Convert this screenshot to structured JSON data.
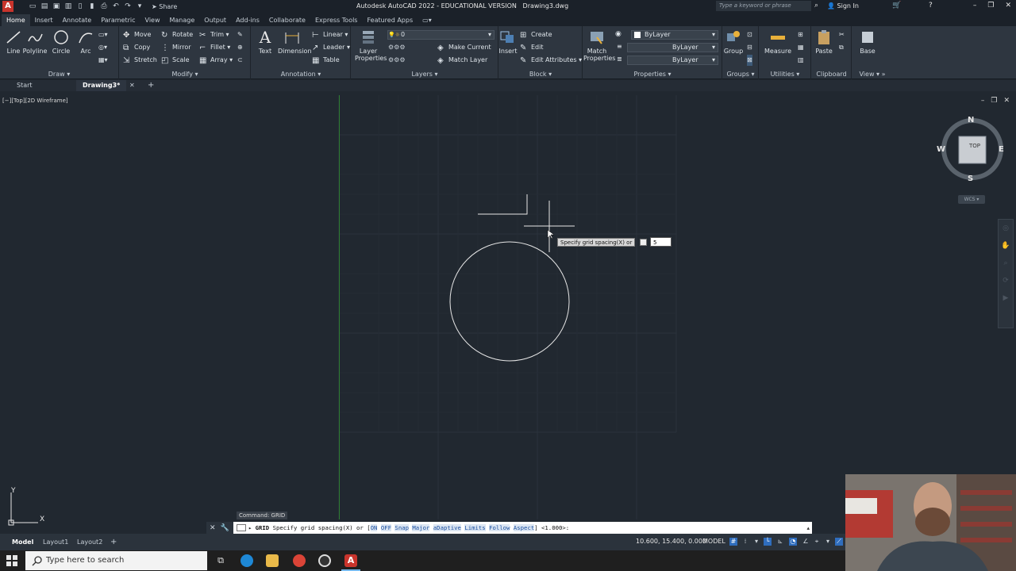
{
  "titlebar": {
    "app_title": "Autodesk AutoCAD 2022 - EDUCATIONAL VERSION",
    "file_name": "Drawing3.dwg",
    "share_label": "Share",
    "search_placeholder": "Type a keyword or phrase",
    "sign_in": "Sign In"
  },
  "ribbon_tabs": [
    "Home",
    "Insert",
    "Annotate",
    "Parametric",
    "View",
    "Manage",
    "Output",
    "Add-ins",
    "Collaborate",
    "Express Tools",
    "Featured Apps"
  ],
  "ribbon": {
    "draw": {
      "title": "Draw",
      "line": "Line",
      "polyline": "Polyline",
      "circle": "Circle",
      "arc": "Arc"
    },
    "modify": {
      "title": "Modify",
      "move": "Move",
      "rotate": "Rotate",
      "trim": "Trim",
      "copy": "Copy",
      "mirror": "Mirror",
      "fillet": "Fillet",
      "stretch": "Stretch",
      "scale": "Scale",
      "array": "Array"
    },
    "annotation": {
      "title": "Annotation",
      "text": "Text",
      "dimension": "Dimension",
      "linear": "Linear",
      "leader": "Leader",
      "table": "Table"
    },
    "layers": {
      "title": "Layers",
      "layer_properties_1": "Layer",
      "layer_properties_2": "Properties",
      "current_layer": "0",
      "make_current": "Make Current",
      "match_layer": "Match Layer"
    },
    "block": {
      "title": "Block",
      "insert": "Insert",
      "create": "Create",
      "edit": "Edit",
      "edit_attributes": "Edit Attributes"
    },
    "properties": {
      "title": "Properties",
      "match_1": "Match",
      "match_2": "Properties",
      "color": "ByLayer",
      "linetype": "ByLayer",
      "lineweight": "ByLayer"
    },
    "groups": {
      "title": "Groups",
      "group": "Group"
    },
    "utilities": {
      "title": "Utilities",
      "measure": "Measure"
    },
    "clipboard": {
      "title": "Clipboard",
      "paste": "Paste"
    },
    "view": {
      "title": "View",
      "base": "Base"
    }
  },
  "file_tabs": {
    "start": "Start",
    "drawing": "Drawing3*"
  },
  "viewport": {
    "label": "[−][Top][2D Wireframe]",
    "viewcube": {
      "n": "N",
      "s": "S",
      "e": "E",
      "w": "W",
      "face": "TOP",
      "wcs": "WCS"
    },
    "ucs": {
      "x": "X",
      "y": "Y"
    }
  },
  "dynamic_input": {
    "prompt": "Specify grid spacing(X) or",
    "value": "5"
  },
  "command": {
    "last": "Command: GRID",
    "name": "GRID",
    "prompt": "Specify grid spacing(X) or [",
    "options": [
      "ON",
      "OFF",
      "Snap",
      "Major",
      "aDaptive",
      "Limits",
      "Follow",
      "Aspect"
    ],
    "suffix": "] <1.000>:"
  },
  "layout_tabs": [
    "Model",
    "Layout1",
    "Layout2"
  ],
  "status": {
    "coords": "10.600, 15.400, 0.000",
    "mode": "MODEL"
  },
  "taskbar": {
    "search_placeholder": "Type here to search"
  },
  "colors": {
    "accent": "#2f6dbd",
    "canvas": "#212830",
    "ribbon": "#2e3640",
    "autocad_red": "#c9342c"
  }
}
